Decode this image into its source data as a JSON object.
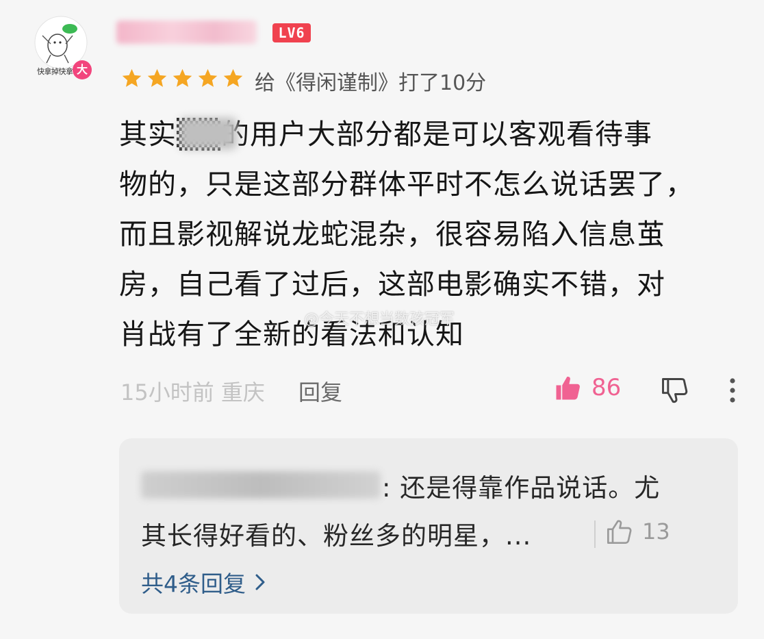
{
  "comment": {
    "avatar": {
      "caption": "快拿掉快拿",
      "badge": "大"
    },
    "level_badge": "LV6",
    "rating": {
      "stars": 5,
      "text": "给《得闲谨制》打了10分"
    },
    "body_lines": [
      "其实▒▒的用户大部分都是可以客观看待事",
      "物的，只是这部分群体平时不怎么说话罢了，",
      "而且影视解说龙蛇混杂，很容易陷入信息茧",
      "房，自己看了过后，这部电影确实不错，对",
      "肖战有了全新的看法和认知"
    ],
    "watermark": "@今天不想当数孩冠军",
    "meta": {
      "time_location": "15小时前 重庆",
      "reply_label": "回复"
    },
    "likes": "86",
    "colors": {
      "like": "#f06292",
      "level": "#f0424f",
      "star": "#f5a623",
      "link": "#2f5d8a"
    }
  },
  "reply_preview": {
    "text_line1": ": 还是得靠作品说话。尤",
    "text_line2": "其长得好看的、粉丝多的明星，...",
    "likes": "13",
    "more_label": "共4条回复"
  }
}
